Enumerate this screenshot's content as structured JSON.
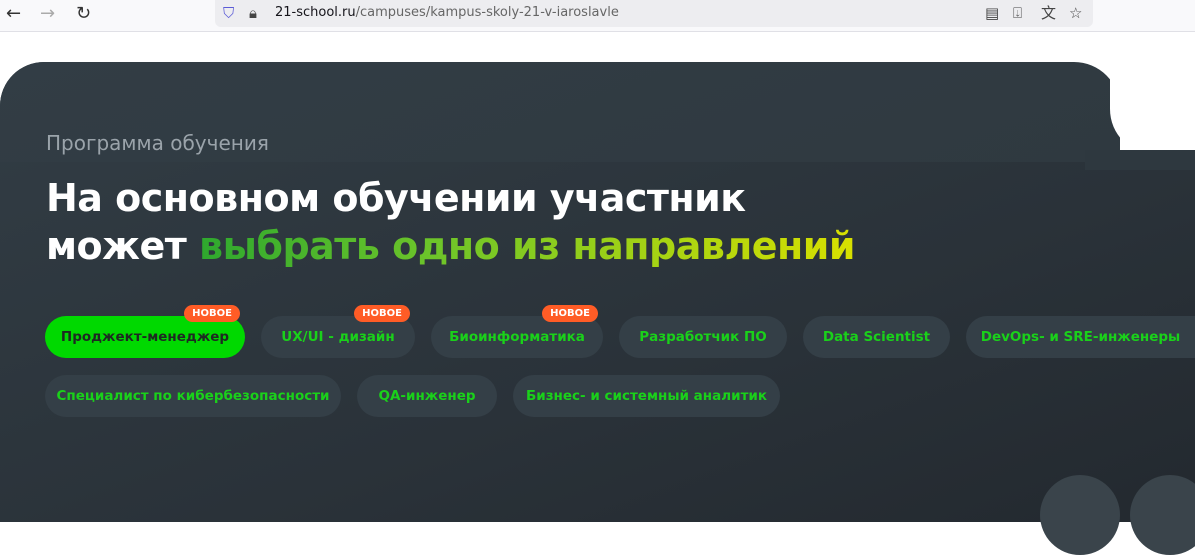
{
  "browser": {
    "url_host": "21-school.ru",
    "url_path": "/campuses/kampus-skoly-21-v-iaroslavle",
    "back": "←",
    "forward": "→",
    "reload": "↻"
  },
  "section": {
    "subtitle": "Программа обучения",
    "title_line1": "На основном обучении участник",
    "title_line2_plain": "может ",
    "title_line2_highlight": "выбрать одно из направлений"
  },
  "badge": "НОВОЕ",
  "programs": [
    {
      "label": "Проджект-менеджер",
      "new": true,
      "active": true
    },
    {
      "label": "UX/UI - дизайн",
      "new": true
    },
    {
      "label": "Биоинформатика",
      "new": true
    },
    {
      "label": "Разработчик ПО"
    },
    {
      "label": "Data Scientist"
    },
    {
      "label": "DevOps- и SRE-инженеры"
    },
    {
      "label": "Специалист по кибербезопасности"
    },
    {
      "label": "QA-инженер"
    },
    {
      "label": "Бизнес- и системный аналитик"
    }
  ]
}
